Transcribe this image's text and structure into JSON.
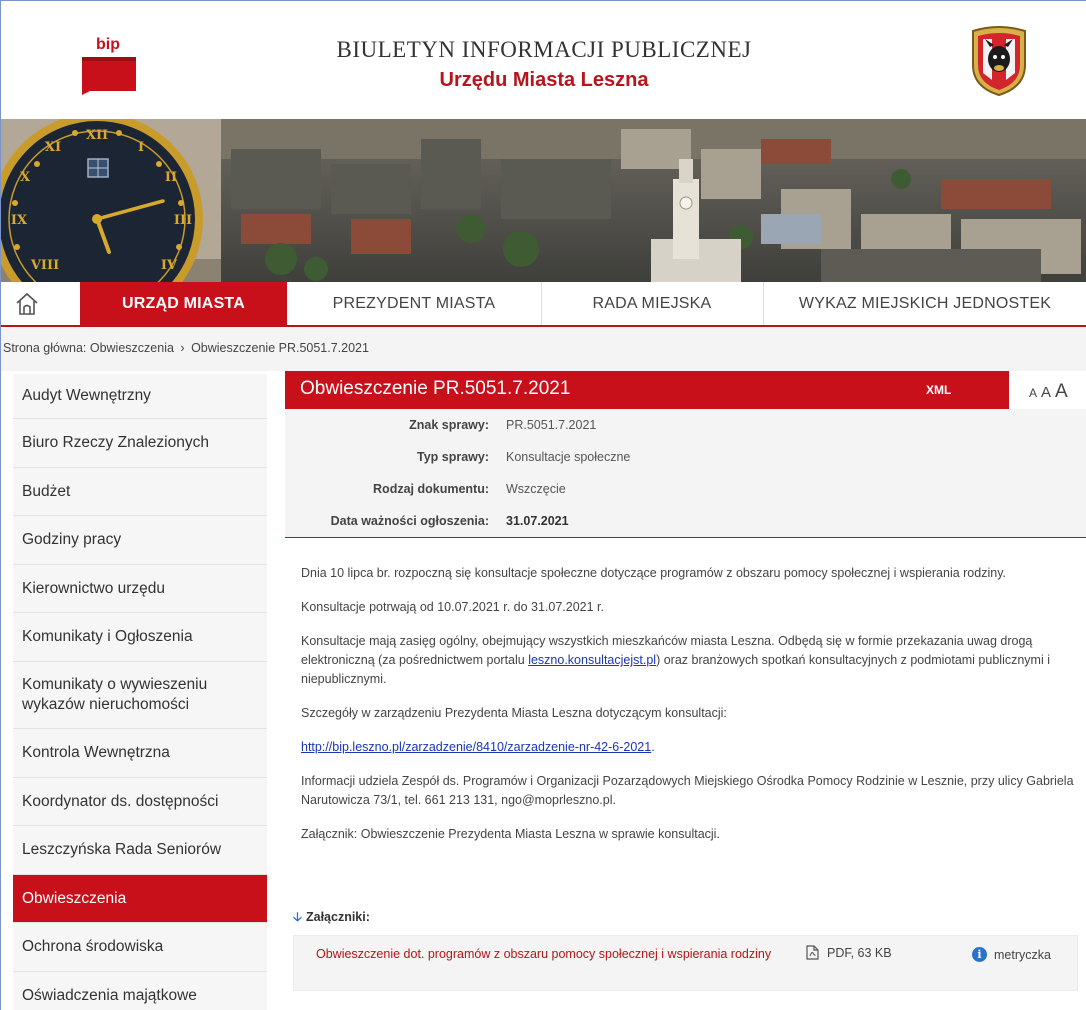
{
  "header": {
    "logo_text": "bip",
    "title": "BIULETYN INFORMACJI PUBLICZNEJ",
    "subtitle": "Urzędu Miasta Leszna"
  },
  "nav": {
    "items": [
      {
        "label": "URZĄD MIASTA",
        "active": true
      },
      {
        "label": "PREZYDENT MIASTA",
        "active": false
      },
      {
        "label": "RADA MIEJSKA",
        "active": false
      },
      {
        "label": "WYKAZ MIEJSKICH JEDNOSTEK",
        "active": false
      }
    ]
  },
  "breadcrumb": {
    "root": "Strona główna: Obwieszczenia",
    "separator": "›",
    "current": "Obwieszczenie PR.5051.7.2021"
  },
  "sidebar": {
    "items": [
      {
        "label": "Audyt Wewnętrzny"
      },
      {
        "label": "Biuro Rzeczy Znalezionych"
      },
      {
        "label": "Budżet"
      },
      {
        "label": "Godziny pracy"
      },
      {
        "label": "Kierownictwo urzędu"
      },
      {
        "label": "Komunikaty i Ogłoszenia"
      },
      {
        "label": "Komunikaty o wywieszeniu wykazów nieruchomości"
      },
      {
        "label": "Kontrola Wewnętrzna"
      },
      {
        "label": "Koordynator ds. dostępności"
      },
      {
        "label": "Leszczyńska Rada Seniorów"
      },
      {
        "label": "Obwieszczenia",
        "active": true
      },
      {
        "label": "Ochrona środowiska"
      },
      {
        "label": "Oświadczenia majątkowe"
      }
    ]
  },
  "document": {
    "title": "Obwieszczenie PR.5051.7.2021",
    "xml_label": "XML",
    "font_small": "A",
    "font_medium": "A",
    "font_large": "A",
    "meta": [
      {
        "label": "Znak sprawy:",
        "value": "PR.5051.7.2021"
      },
      {
        "label": "Typ sprawy:",
        "value": "Konsultacje społeczne"
      },
      {
        "label": "Rodzaj dokumentu:",
        "value": "Wszczęcie"
      },
      {
        "label": "Data ważności ogłoszenia:",
        "value": "31.07.2021"
      }
    ],
    "p1": "Dnia 10 lipca br. rozpoczną się konsultacje społeczne dotyczące programów z obszaru pomocy społecznej i wspierania rodziny.",
    "p2": "Konsultacje potrwają od 10.07.2021 r. do 31.07.2021 r.",
    "p3_before": "Konsultacje mają zasięg ogólny, obejmujący wszystkich mieszkańców miasta Leszna. Odbędą się w formie przekazania uwag drogą elektroniczną (za pośrednictwem portalu ",
    "p3_link": "leszno.konsultacjejst.pl",
    "p3_after": ") oraz branżowych spotkań konsultacyjnych z podmiotami publicznymi i niepublicznymi.",
    "p4": "Szczegóły w zarządzeniu Prezydenta Miasta Leszna dotyczącym konsultacji:",
    "p5_link": "http://bip.leszno.pl/zarzadzenie/8410/zarzadzenie-nr-42-6-2021",
    "p5_after": ".",
    "p6": "Informacji udziela Zespół ds. Programów i Organizacji Pozarządowych Miejskiego Ośrodka Pomocy Rodzinie w Lesznie, przy  ulicy  Gabriela Narutowicza 73/1, tel. 661 213 131, ngo@mopr­leszno.pl.",
    "p7": "Załącznik: Obwieszczenie Prezydenta Miasta Leszna w sprawie konsultacji."
  },
  "attachments": {
    "heading": "Załączniki:",
    "items": [
      {
        "name": "Obwieszczenie dot. programów z obszaru pomocy społecznej i wspierania rodziny",
        "file_info": "PDF, 63 KB",
        "meta_label": "metryczka"
      }
    ]
  },
  "colors": {
    "brand_red": "#c8101b",
    "link_blue": "#1a35b8",
    "info_blue": "#2873c9"
  }
}
